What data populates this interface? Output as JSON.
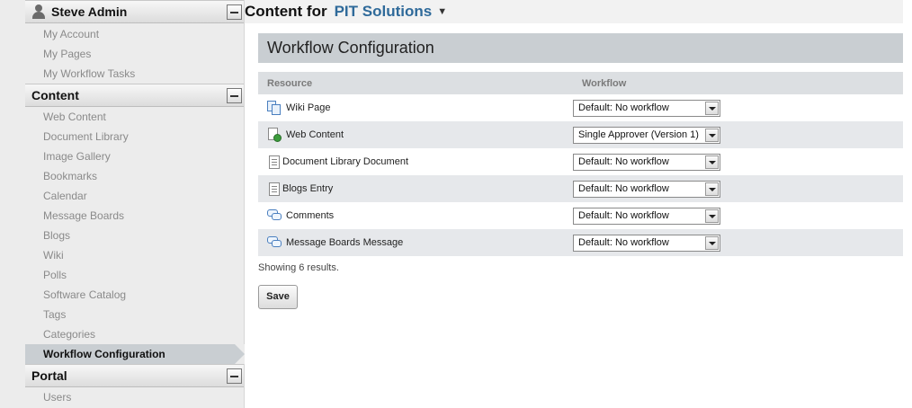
{
  "sidebar": {
    "user_panel": {
      "title": "Steve Admin",
      "items": [
        "My Account",
        "My Pages",
        "My Workflow Tasks"
      ]
    },
    "content_panel": {
      "title": "Content",
      "items": [
        "Web Content",
        "Document Library",
        "Image Gallery",
        "Bookmarks",
        "Calendar",
        "Message Boards",
        "Blogs",
        "Wiki",
        "Polls",
        "Software Catalog",
        "Tags",
        "Categories",
        "Workflow Configuration"
      ],
      "selected": "Workflow Configuration"
    },
    "portal_panel": {
      "title": "Portal",
      "items": [
        "Users"
      ]
    }
  },
  "header": {
    "prefix": "Content for",
    "site_name": "PIT Solutions"
  },
  "portlet": {
    "title": "Workflow Configuration",
    "columns": {
      "resource": "Resource",
      "workflow": "Workflow"
    },
    "rows": [
      {
        "resource": "Wiki Page",
        "icon": "wiki-page-icon",
        "workflow": "Default: No workflow"
      },
      {
        "resource": "Web Content",
        "icon": "web-content-icon",
        "workflow": "Single Approver (Version 1)"
      },
      {
        "resource": "Document Library Document",
        "icon": "document-icon",
        "workflow": "Default: No workflow"
      },
      {
        "resource": "Blogs Entry",
        "icon": "document-icon",
        "workflow": "Default: No workflow"
      },
      {
        "resource": "Comments",
        "icon": "comments-icon",
        "workflow": "Default: No workflow"
      },
      {
        "resource": "Message Boards Message",
        "icon": "comments-icon",
        "workflow": "Default: No workflow"
      }
    ],
    "results_text": "Showing 6 results.",
    "save_label": "Save"
  },
  "colors": {
    "site_link": "#2f6a9a",
    "selected_bg": "#c9ced2",
    "row_alt_bg": "#e6e8eb"
  }
}
